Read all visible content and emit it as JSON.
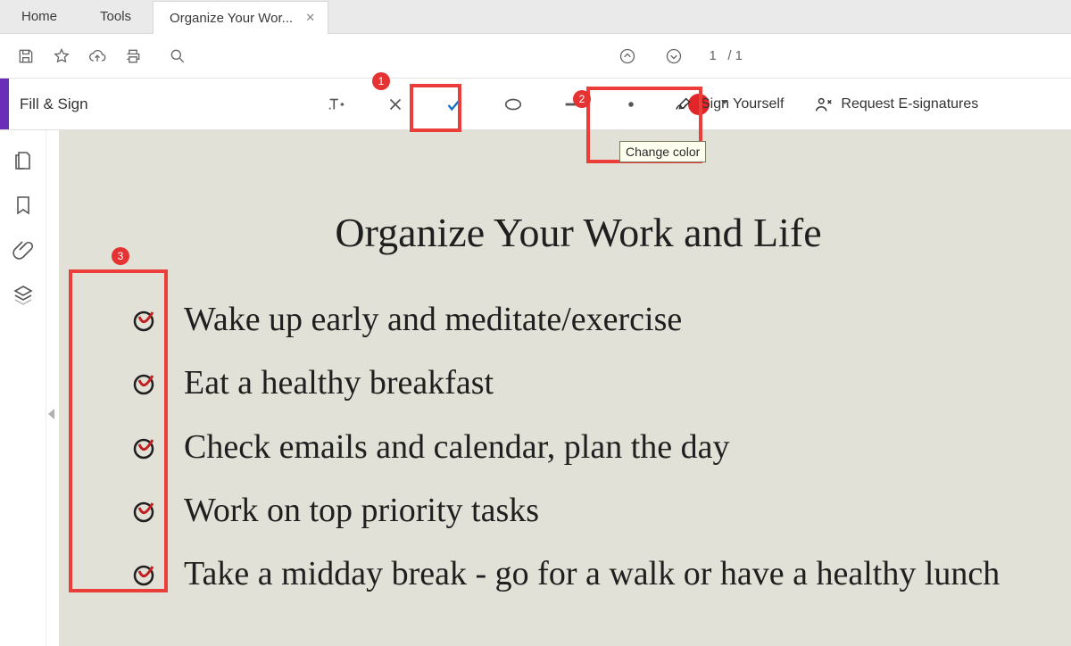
{
  "tabs": {
    "home": "Home",
    "tools": "Tools",
    "doc_label": "Organize Your Wor..."
  },
  "page_nav": {
    "current": "1",
    "sep": "/ 1"
  },
  "fillsign": {
    "label": "Fill & Sign",
    "color": "#e1262a",
    "tooltip": "Change color",
    "sign_self": "Sign Yourself",
    "request": "Request E-signatures"
  },
  "annotations": {
    "badge1": "1",
    "badge2": "2",
    "badge3": "3"
  },
  "document": {
    "title": "Organize Your Work and Life",
    "items": [
      "Wake up early and meditate/exercise",
      "Eat a healthy breakfast",
      "Check emails and calendar, plan the day",
      "Work on top priority tasks",
      "Take a midday break - go for a walk or have a healthy lunch"
    ]
  }
}
